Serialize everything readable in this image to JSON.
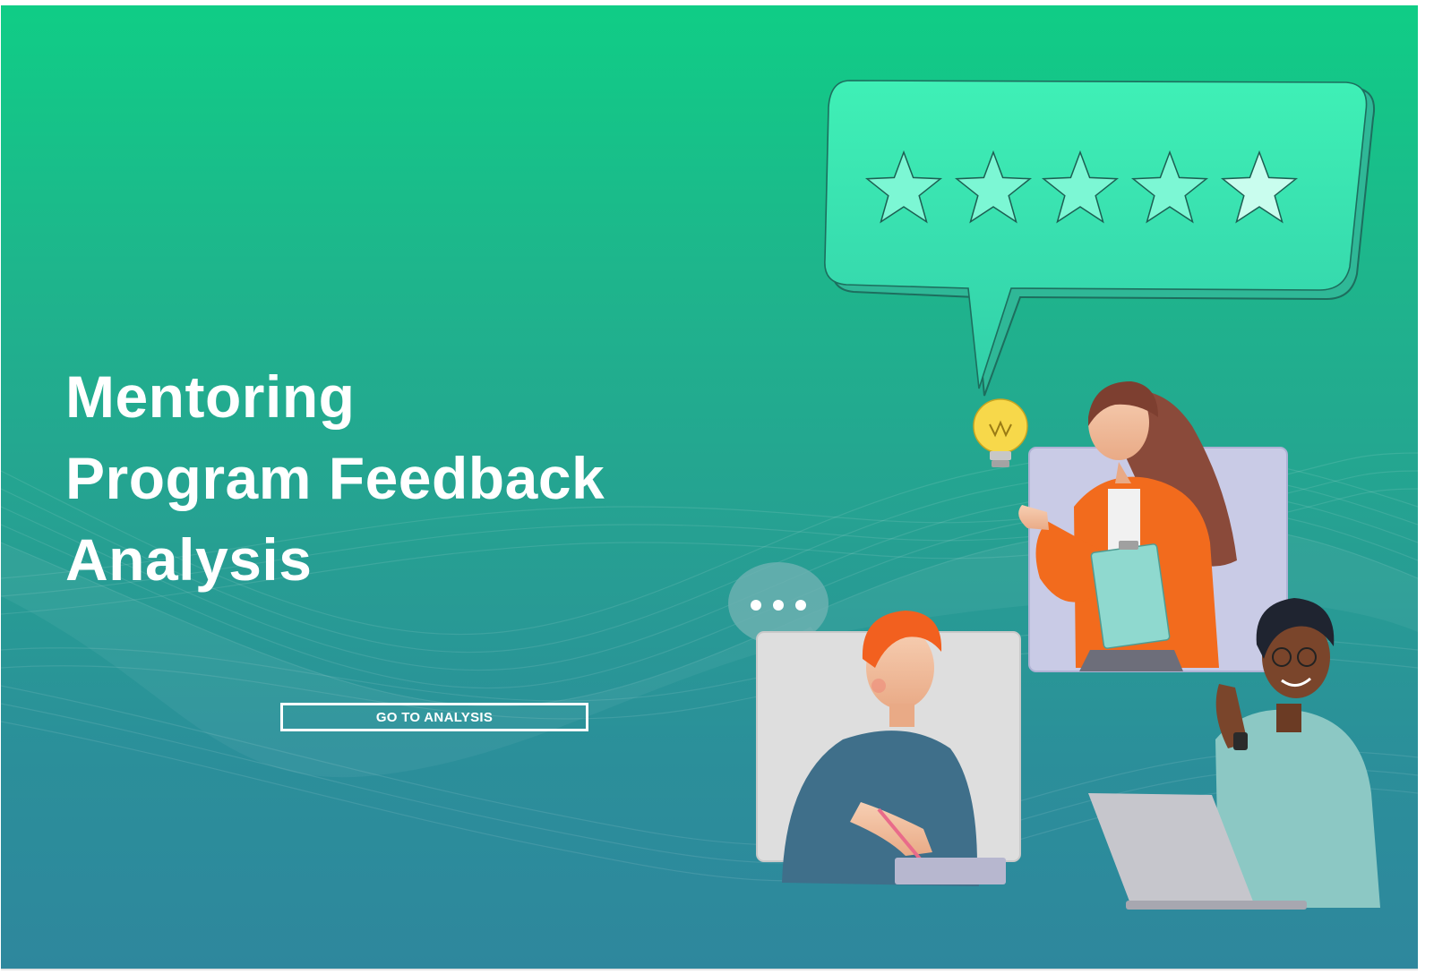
{
  "hero": {
    "title_lines": [
      "Mentoring",
      "Program Feedback",
      "Analysis"
    ],
    "cta_label": "GO TO ANALYSIS"
  },
  "rating": {
    "value": 5,
    "max": 5
  },
  "icons": {
    "star": "star-icon",
    "lightbulb": "lightbulb-icon",
    "speech": "speech-bubble-icon",
    "typing": "typing-bubble-icon"
  },
  "colors": {
    "gradient_top": "#10cd86",
    "gradient_bottom": "#2e879d",
    "bubble": "#3ee0b0",
    "star": "#7cf7d4",
    "accent_orange": "#f26b1d",
    "bulb": "#f7d84a"
  }
}
